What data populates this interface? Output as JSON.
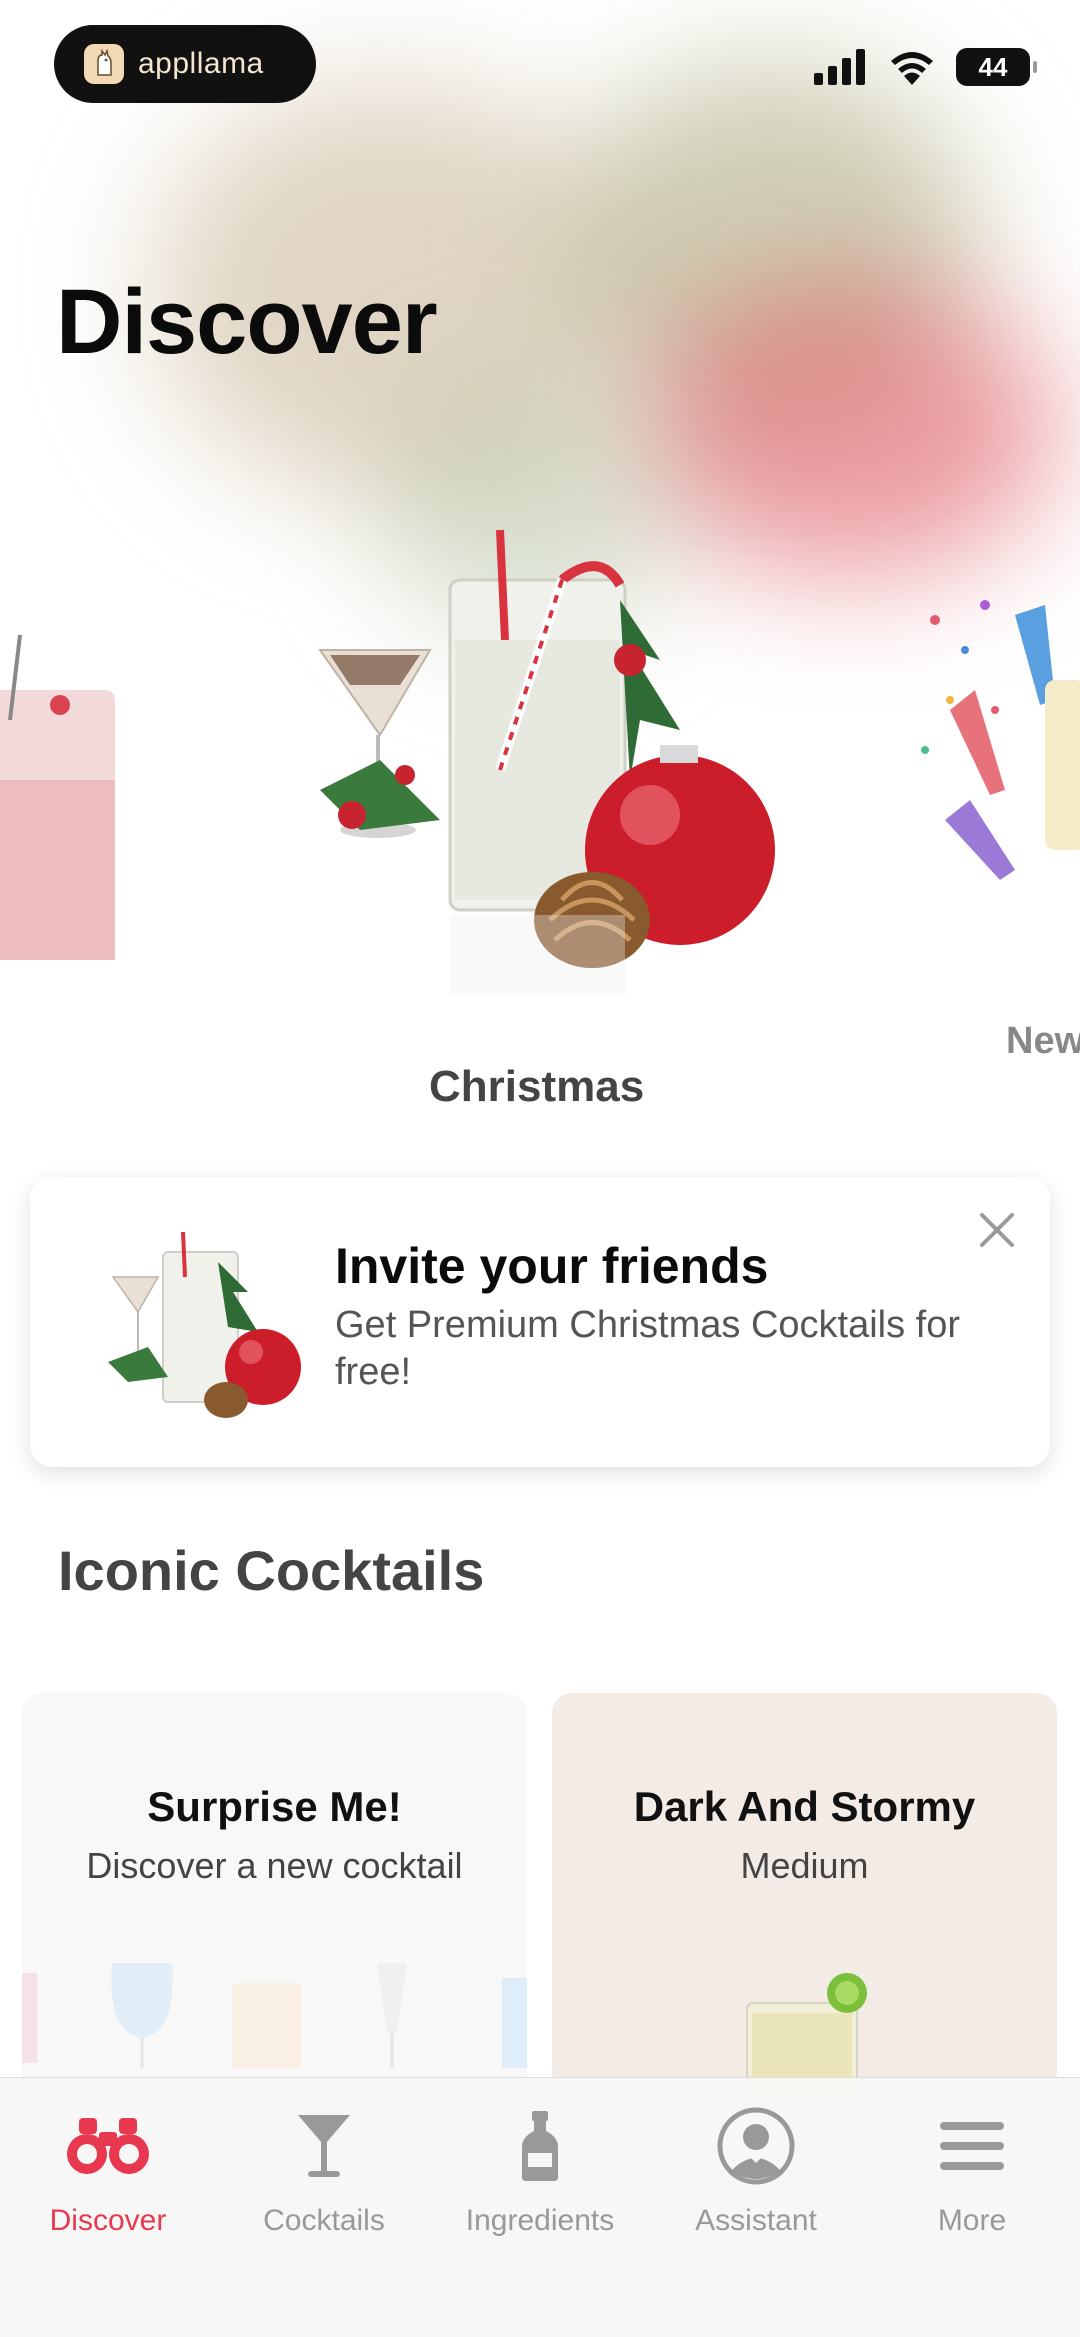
{
  "status_bar": {
    "brand": "appllama",
    "battery": "44"
  },
  "page_title": "Discover",
  "carousel": {
    "items": [
      {
        "label": "Christmas"
      },
      {
        "label": "New"
      }
    ]
  },
  "invite": {
    "title": "Invite your friends",
    "subtitle": "Get Premium Christmas Cocktails for free!"
  },
  "section": {
    "title": "Iconic Cocktails"
  },
  "tiles": [
    {
      "title": "Surprise Me!",
      "subtitle": "Discover a new cocktail"
    },
    {
      "title": "Dark And Stormy",
      "subtitle": "Medium"
    }
  ],
  "tabs": [
    {
      "label": "Discover",
      "icon": "binoculars-icon",
      "active": true
    },
    {
      "label": "Cocktails",
      "icon": "cocktail-glass-icon"
    },
    {
      "label": "Ingredients",
      "icon": "bottle-icon"
    },
    {
      "label": "Assistant",
      "icon": "bartender-avatar-icon"
    },
    {
      "label": "More",
      "icon": "menu-icon"
    }
  ],
  "colors": {
    "accent": "#e8384f",
    "tab_inactive": "#999999"
  }
}
